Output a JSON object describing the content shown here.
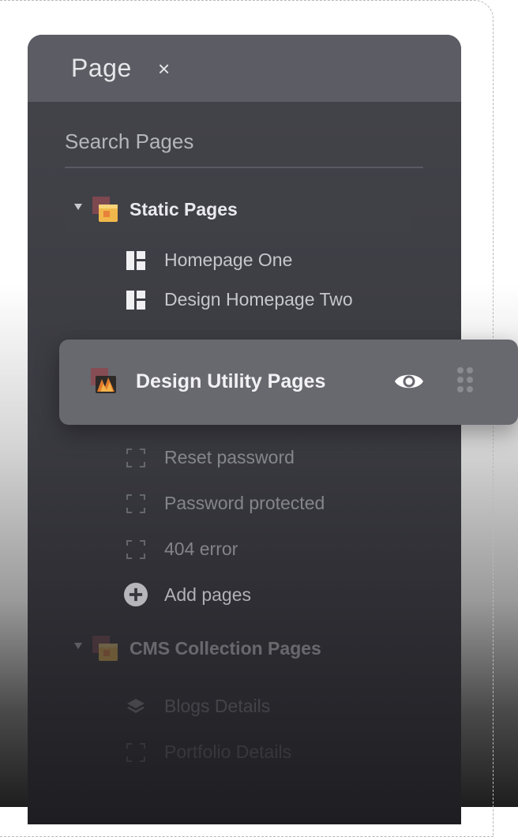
{
  "panel": {
    "title": "Page",
    "close_glyph": "×",
    "search_placeholder": "Search Pages"
  },
  "groups": {
    "static": {
      "label": "Static Pages",
      "items": [
        {
          "label": "Homepage One",
          "icon": "layout-icon"
        },
        {
          "label": "Design Homepage Two",
          "icon": "layout-icon"
        }
      ]
    },
    "utility": {
      "label": "Design Utility Pages",
      "items": [
        {
          "label": "Reset password",
          "icon": "dashed-frame-icon"
        },
        {
          "label": "Password protected",
          "icon": "dashed-frame-icon"
        },
        {
          "label": "404 error",
          "icon": "dashed-frame-icon"
        }
      ],
      "add_label": "Add pages"
    },
    "cms": {
      "label": "CMS Collection Pages",
      "items": [
        {
          "label": "Blogs Details",
          "icon": "layers-icon"
        },
        {
          "label": "Portfolio Details",
          "icon": "dashed-frame-icon"
        }
      ]
    }
  },
  "colors": {
    "panel_bg": "#3a3a41",
    "header_bg": "#5c5c64",
    "drag_card_bg": "#68686f",
    "text_primary": "#e9e9ee"
  }
}
